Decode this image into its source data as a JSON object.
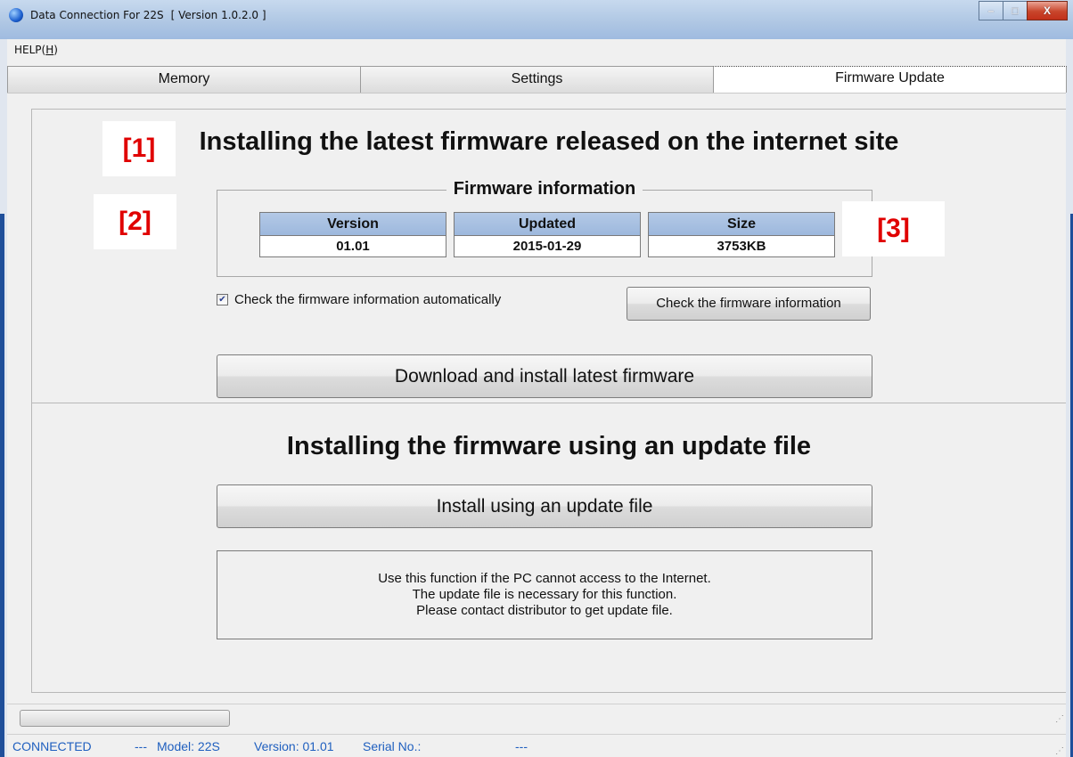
{
  "window": {
    "app_name": "Data Connection For 22S",
    "version_label": "[ Version 1.0.2.0 ]",
    "buttons": {
      "minimize": "–",
      "maximize": "□",
      "close": "X"
    }
  },
  "menu": {
    "help_prefix": "HELP(",
    "help_key": "H",
    "help_suffix": ")"
  },
  "tabs": [
    {
      "label": "Memory",
      "active": false
    },
    {
      "label": "Settings",
      "active": false
    },
    {
      "label": "Firmware Update",
      "active": true
    }
  ],
  "online_section": {
    "heading": "Installing the latest firmware released on the internet site",
    "group_title": "Firmware information",
    "columns": [
      {
        "header": "Version",
        "value": "01.01"
      },
      {
        "header": "Updated",
        "value": "2015-01-29"
      },
      {
        "header": "Size",
        "value": "3753KB"
      }
    ],
    "auto_check": {
      "label": "Check the firmware information automatically",
      "checked": true
    },
    "check_button": "Check the firmware information",
    "download_button": "Download and install latest firmware"
  },
  "callouts": {
    "c1": "[1]",
    "c2": "[2]",
    "c3": "[3]"
  },
  "file_section": {
    "heading": "Installing the firmware using an update file",
    "install_button": "Install using an update file",
    "note_lines": [
      "Use this function if the PC cannot access to the Internet.",
      "The update file is necessary for this function.",
      "Please contact distributor to get update file."
    ]
  },
  "status": {
    "connection": "CONNECTED",
    "separator1": "---",
    "model": "Model: 22S",
    "version": "Version: 01.01",
    "serial": "Serial No.:",
    "separator2": "---"
  },
  "progress": {
    "value": 0
  }
}
